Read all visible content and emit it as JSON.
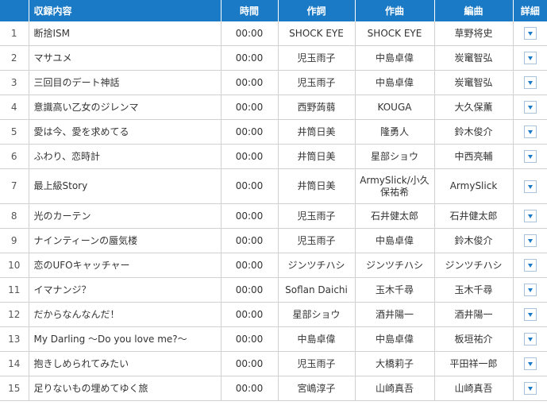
{
  "headers": {
    "no": "",
    "title": "収録内容",
    "time": "時間",
    "lyrics": "作詞",
    "music": "作曲",
    "arrangement": "編曲",
    "detail": "詳細"
  },
  "tracks": [
    {
      "no": "1",
      "title": "断捨ISM",
      "time": "00:00",
      "lyrics": "SHOCK EYE",
      "music": "SHOCK EYE",
      "arrangement": "草野将史"
    },
    {
      "no": "2",
      "title": "マサユメ",
      "time": "00:00",
      "lyrics": "児玉雨子",
      "music": "中島卓偉",
      "arrangement": "炭竃智弘"
    },
    {
      "no": "3",
      "title": "三回目のデート神話",
      "time": "00:00",
      "lyrics": "児玉雨子",
      "music": "中島卓偉",
      "arrangement": "炭竃智弘"
    },
    {
      "no": "4",
      "title": "意識高い乙女のジレンマ",
      "time": "00:00",
      "lyrics": "西野蒟蒻",
      "music": "KOUGA",
      "arrangement": "大久保薫"
    },
    {
      "no": "5",
      "title": "愛は今、愛を求めてる",
      "time": "00:00",
      "lyrics": "井筒日美",
      "music": "隆勇人",
      "arrangement": "鈴木俊介"
    },
    {
      "no": "6",
      "title": "ふわり、恋時計",
      "time": "00:00",
      "lyrics": "井筒日美",
      "music": "星部ショウ",
      "arrangement": "中西亮輔"
    },
    {
      "no": "7",
      "title": "最上級Story",
      "time": "00:00",
      "lyrics": "井筒日美",
      "music": "ArmySlick/小久保祐希",
      "arrangement": "ArmySlick"
    },
    {
      "no": "8",
      "title": "光のカーテン",
      "time": "00:00",
      "lyrics": "児玉雨子",
      "music": "石井健太郎",
      "arrangement": "石井健太郎"
    },
    {
      "no": "9",
      "title": "ナインティーンの蜃気楼",
      "time": "00:00",
      "lyrics": "児玉雨子",
      "music": "中島卓偉",
      "arrangement": "鈴木俊介"
    },
    {
      "no": "10",
      "title": "恋のUFOキャッチャー",
      "time": "00:00",
      "lyrics": "ジンツチハシ",
      "music": "ジンツチハシ",
      "arrangement": "ジンツチハシ"
    },
    {
      "no": "11",
      "title": "イマナンジ？",
      "time": "00:00",
      "lyrics": "Soflan Daichi",
      "music": "玉木千尋",
      "arrangement": "玉木千尋"
    },
    {
      "no": "12",
      "title": "だからなんなんだ！",
      "time": "00:00",
      "lyrics": "星部ショウ",
      "music": "酒井陽一",
      "arrangement": "酒井陽一"
    },
    {
      "no": "13",
      "title": "My Darling ～Do you love me?～",
      "time": "00:00",
      "lyrics": "中島卓偉",
      "music": "中島卓偉",
      "arrangement": "板垣祐介"
    },
    {
      "no": "14",
      "title": "抱きしめられてみたい",
      "time": "00:00",
      "lyrics": "児玉雨子",
      "music": "大橋莉子",
      "arrangement": "平田祥一郎"
    },
    {
      "no": "15",
      "title": "足りないもの埋めてゆく旅",
      "time": "00:00",
      "lyrics": "宮嶋淳子",
      "music": "山崎真吾",
      "arrangement": "山崎真吾"
    }
  ],
  "colors": {
    "header_bg": "#1a7ac6",
    "header_text": "#ffffff",
    "border": "#d0d0d0",
    "arrow": "#1a7ac6"
  },
  "icons": {
    "detail_toggle": "chevron-down-icon"
  }
}
